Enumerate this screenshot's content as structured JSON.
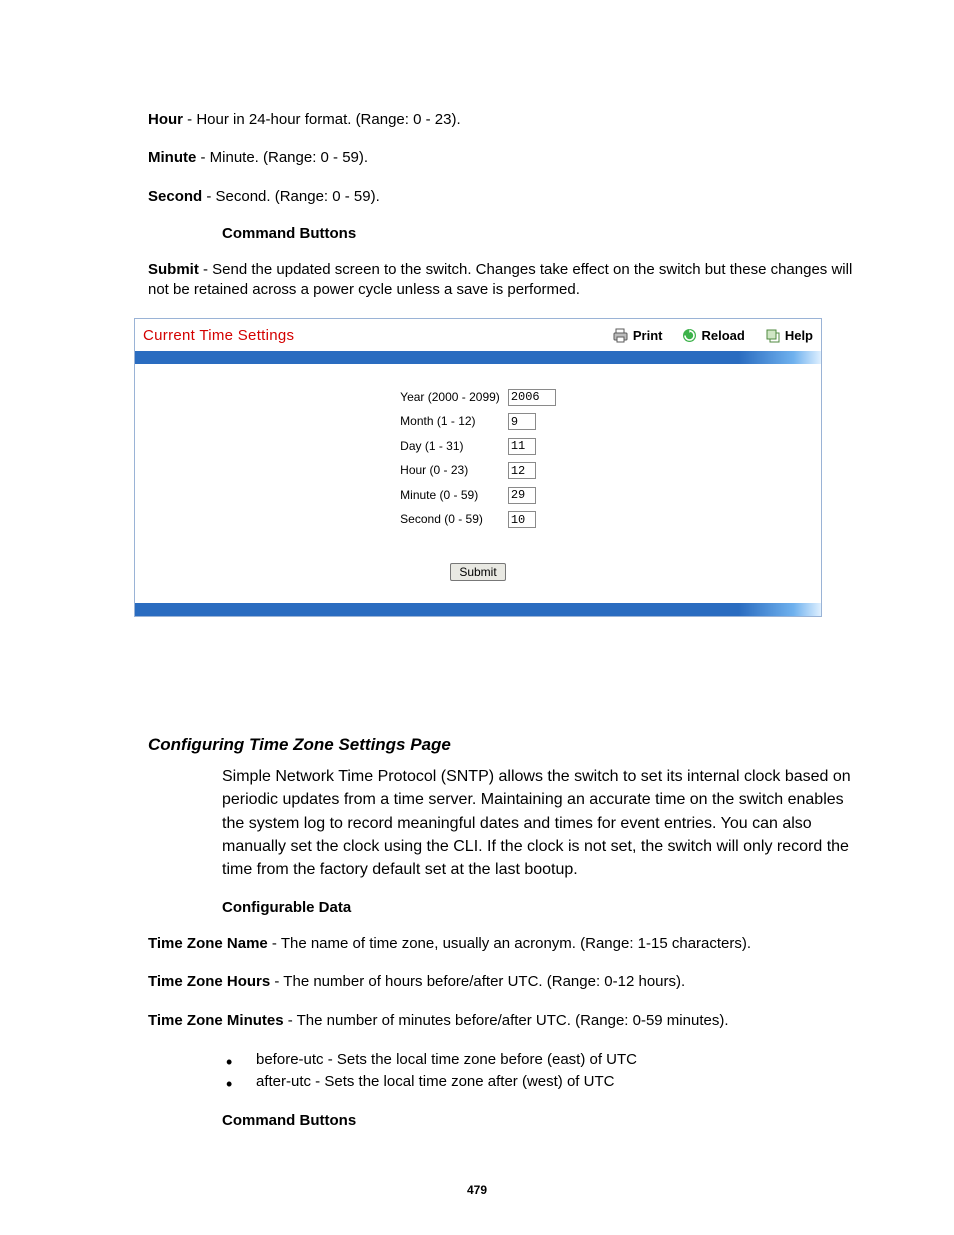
{
  "defs": {
    "hour": {
      "term": "Hour",
      "text": " - Hour in 24-hour format. (Range: 0 - 23)."
    },
    "minute": {
      "term": "Minute",
      "text": " - Minute. (Range: 0 - 59)."
    },
    "second": {
      "term": "Second",
      "text": " - Second. (Range: 0 - 59)."
    }
  },
  "cmd_heading": "Command Buttons",
  "submit_desc": {
    "term": "Submit",
    "text": " - Send the updated screen to the switch. Changes take effect on the switch but these changes will not be retained across a power cycle unless a save is performed."
  },
  "panel": {
    "title": "Current Time Settings",
    "actions": {
      "print": "Print",
      "reload": "Reload",
      "help": "Help"
    },
    "fields": {
      "year": {
        "label": "Year (2000 - 2099)",
        "value": "2006"
      },
      "month": {
        "label": "Month (1 - 12)",
        "value": "9"
      },
      "day": {
        "label": "Day (1 - 31)",
        "value": "11"
      },
      "hour": {
        "label": "Hour (0 - 23)",
        "value": "12"
      },
      "minute": {
        "label": "Minute (0 - 59)",
        "value": "29"
      },
      "second": {
        "label": "Second (0 - 59)",
        "value": "10"
      }
    },
    "submit": "Submit"
  },
  "tz_section": {
    "title": "Configuring Time Zone Settings Page",
    "intro": "Simple Network Time Protocol (SNTP) allows the switch to set its internal clock based on periodic updates from a time server. Maintaining an accurate time on the switch enables the system log to record meaningful dates and times for event entries. You can also manually set the clock using the CLI. If the clock is not set, the switch will only record the time from the factory default set at the last bootup.",
    "config_heading": "Configurable Data",
    "tz_name": {
      "term": "Time Zone Name",
      "text": " - The name of time zone, usually an acronym. (Range: 1-15 characters)."
    },
    "tz_hours": {
      "term": "Time Zone Hours",
      "text": " - The number of hours before/after UTC. (Range: 0-12 hours)."
    },
    "tz_minutes": {
      "term": "Time Zone Minutes",
      "text": " - The number of minutes before/after UTC. (Range: 0-59 minutes)."
    },
    "bullets": {
      "before": "before-utc - Sets the local time zone before (east) of UTC",
      "after": "after-utc - Sets the local time zone after (west) of UTC"
    }
  },
  "page_number": "479"
}
